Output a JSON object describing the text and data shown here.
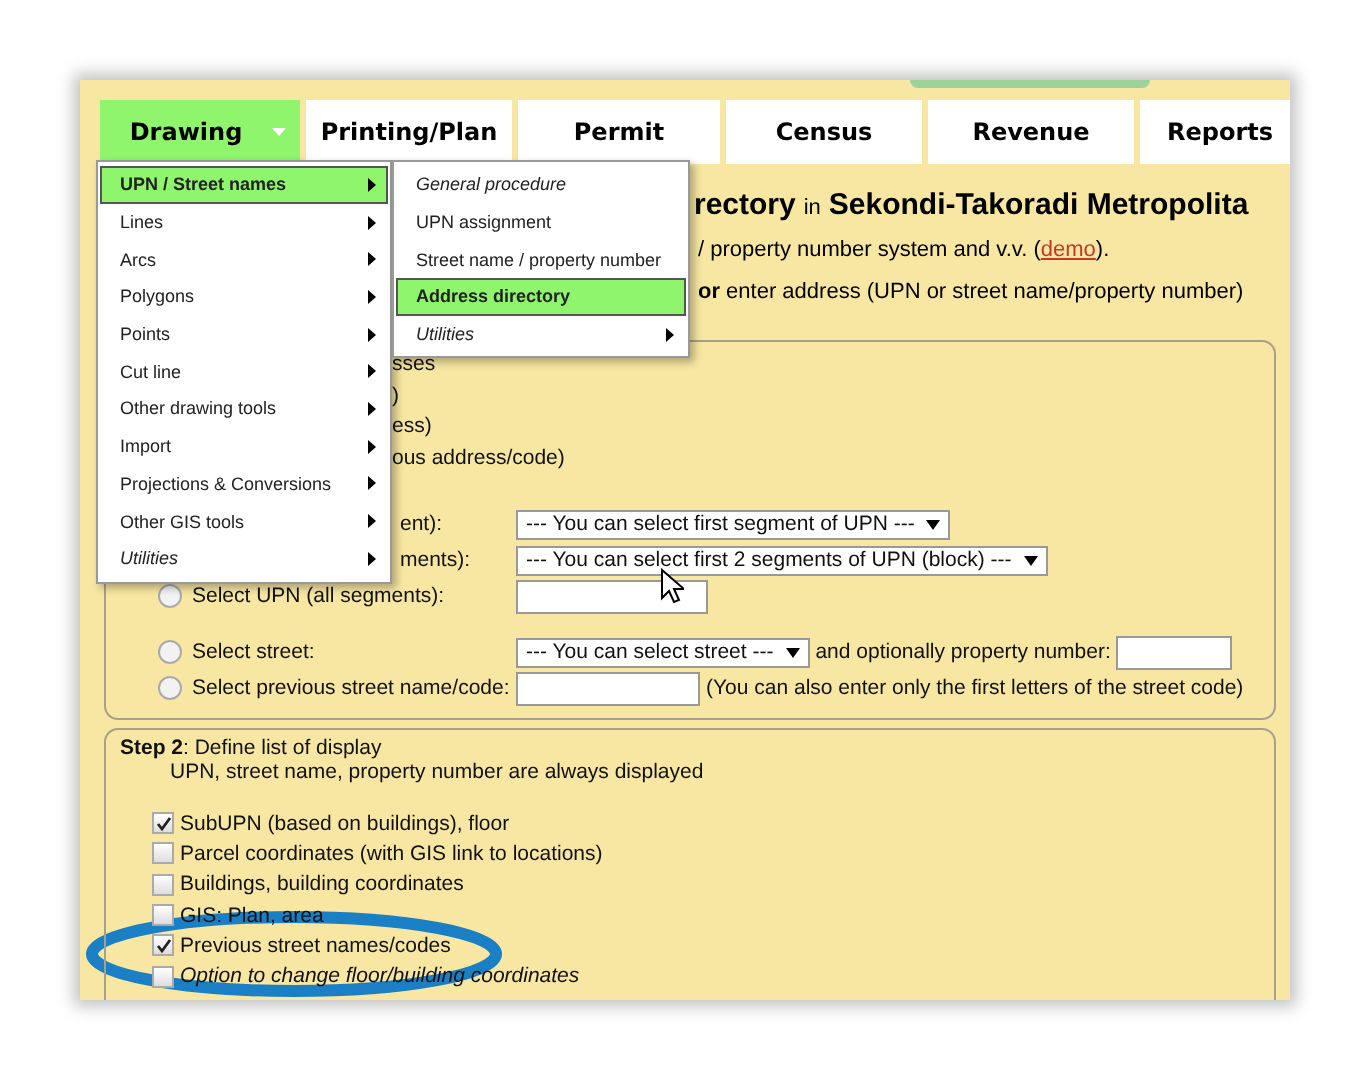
{
  "tabs": [
    {
      "label": "Drawing",
      "selected": true,
      "dropdown": true
    },
    {
      "label": "Printing/Plan",
      "selected": false,
      "dropdown": false
    },
    {
      "label": "Permit",
      "selected": false,
      "dropdown": false
    },
    {
      "label": "Census",
      "selected": false,
      "dropdown": false
    },
    {
      "label": "Revenue",
      "selected": false,
      "dropdown": false
    },
    {
      "label": "Reports",
      "selected": false,
      "dropdown": false
    }
  ],
  "menu": {
    "items": [
      {
        "label": "UPN / Street names",
        "selected": true,
        "italic": false,
        "submenu": true
      },
      {
        "label": "Lines",
        "selected": false,
        "italic": false,
        "submenu": true
      },
      {
        "label": "Arcs",
        "selected": false,
        "italic": false,
        "submenu": true
      },
      {
        "label": "Polygons",
        "selected": false,
        "italic": false,
        "submenu": true
      },
      {
        "label": "Points",
        "selected": false,
        "italic": false,
        "submenu": true
      },
      {
        "label": "Cut line",
        "selected": false,
        "italic": false,
        "submenu": true
      },
      {
        "label": "Other drawing tools",
        "selected": false,
        "italic": false,
        "submenu": true
      },
      {
        "label": "Import",
        "selected": false,
        "italic": false,
        "submenu": true
      },
      {
        "label": "Projections & Conversions",
        "selected": false,
        "italic": false,
        "submenu": true
      },
      {
        "label": "Other GIS tools",
        "selected": false,
        "italic": false,
        "submenu": true
      },
      {
        "label": "Utilities",
        "selected": false,
        "italic": true,
        "submenu": true
      }
    ]
  },
  "submenu": {
    "items": [
      {
        "label": "General procedure",
        "selected": false,
        "italic": true,
        "submenu": false
      },
      {
        "label": "UPN assignment",
        "selected": false,
        "italic": false,
        "submenu": false
      },
      {
        "label": "Street name / property number",
        "selected": false,
        "italic": false,
        "submenu": false
      },
      {
        "label": "Address directory",
        "selected": true,
        "italic": false,
        "submenu": false
      },
      {
        "label": "Utilities",
        "selected": false,
        "italic": true,
        "submenu": true
      }
    ]
  },
  "heading": [
    {
      "text": "rectory",
      "bold": true
    },
    {
      "text": "in",
      "bold": false
    },
    {
      "text": "Sekondi-Takoradi Metropolita",
      "bold": true
    }
  ],
  "intro": {
    "before": "/ property number system and v.v. (",
    "link": "demo",
    "after": ")."
  },
  "prompt": "**or** enter address (UPN or street name/property number)",
  "step1": {
    "fragments": [
      "sses",
      ")",
      "ess)",
      "ous address/code)"
    ],
    "rows": [
      {
        "label": "ent):",
        "controls": [
          {
            "kind": "select",
            "value": "--- You can select first segment of UPN ---"
          }
        ]
      },
      {
        "label": "ments):",
        "controls": [
          {
            "kind": "select",
            "value": "--- You can select first 2 segments of UPN (block) ---"
          }
        ]
      },
      {
        "label": "Select UPN (all segments):",
        "radio": {
          "selected": false
        },
        "controls": [
          {
            "kind": "input"
          }
        ]
      },
      {
        "label": "Select street:",
        "radio": {
          "selected": false
        },
        "controls": [
          {
            "kind": "select",
            "value": "--- You can select street ---"
          },
          {
            "kind": "text",
            "value": "and optionally property number:"
          },
          {
            "kind": "input"
          }
        ]
      },
      {
        "label": "Select previous street name/code:",
        "radio": {
          "selected": false
        },
        "controls": [
          {
            "kind": "input"
          },
          {
            "kind": "text",
            "value": "(You can also enter only the first letters of the street code)"
          }
        ]
      }
    ]
  },
  "step2": {
    "title": "**Step 2**: Define list of display",
    "note": "UPN, street name, property number are always displayed",
    "options": [
      {
        "label": "SubUPN (based on buildings), floor",
        "checked": true,
        "italic": false
      },
      {
        "label": "Parcel coordinates (with GIS link to locations)",
        "checked": false,
        "italic": false
      },
      {
        "label": "Buildings, building coordinates",
        "checked": false,
        "italic": false
      },
      {
        "label": "GIS: Plan, area",
        "checked": false,
        "italic": false
      },
      {
        "label": "Previous street names/codes",
        "checked": true,
        "italic": false
      },
      {
        "label": "Option to change floor/building coordinates",
        "checked": false,
        "italic": true
      }
    ]
  },
  "annotation": {
    "kind": "ellipse"
  }
}
